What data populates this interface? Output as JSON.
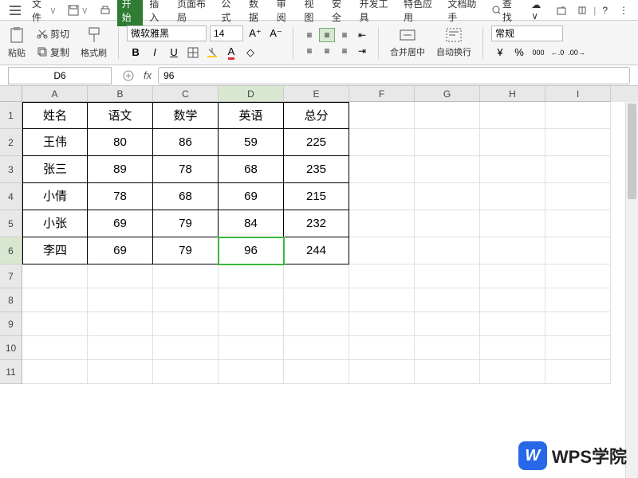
{
  "menubar": {
    "file": "文件",
    "tabs": [
      "开始",
      "插入",
      "页面布局",
      "公式",
      "数据",
      "审阅",
      "视图",
      "安全",
      "开发工具",
      "特色应用",
      "文档助手"
    ],
    "search": "查找"
  },
  "ribbon": {
    "clipboard": {
      "cut": "剪切",
      "copy": "复制",
      "paste": "粘贴",
      "painter": "格式刷"
    },
    "font": {
      "name": "微软雅黑",
      "size": "14"
    },
    "merge": "合并居中",
    "wrap": "自动换行",
    "format_label": "常规",
    "currency": "¥",
    "percent": "%",
    "thousand": "000",
    "dec_inc": ".0",
    "dec_dec": ".00"
  },
  "namebox": "D6",
  "formula": "96",
  "columns": [
    "A",
    "B",
    "C",
    "D",
    "E",
    "F",
    "G",
    "H",
    "I"
  ],
  "rows": [
    "1",
    "2",
    "3",
    "4",
    "5",
    "6",
    "7",
    "8",
    "9",
    "10",
    "11"
  ],
  "headers": [
    "姓名",
    "语文",
    "数学",
    "英语",
    "总分"
  ],
  "data": [
    [
      "王伟",
      "80",
      "86",
      "59",
      "225"
    ],
    [
      "张三",
      "89",
      "78",
      "68",
      "235"
    ],
    [
      "小倩",
      "78",
      "68",
      "69",
      "215"
    ],
    [
      "小张",
      "69",
      "79",
      "84",
      "232"
    ],
    [
      "李四",
      "69",
      "79",
      "96",
      "244"
    ]
  ],
  "chart_data": {
    "type": "table",
    "columns": [
      "姓名",
      "语文",
      "数学",
      "英语",
      "总分"
    ],
    "rows": [
      {
        "姓名": "王伟",
        "语文": 80,
        "数学": 86,
        "英语": 59,
        "总分": 225
      },
      {
        "姓名": "张三",
        "语文": 89,
        "数学": 78,
        "英语": 68,
        "总分": 235
      },
      {
        "姓名": "小倩",
        "语文": 78,
        "数学": 68,
        "英语": 69,
        "总分": 215
      },
      {
        "姓名": "小张",
        "语文": 69,
        "数学": 79,
        "英语": 84,
        "总分": 232
      },
      {
        "姓名": "李四",
        "语文": 69,
        "数学": 79,
        "英语": 96,
        "总分": 244
      }
    ]
  },
  "selected": {
    "col": "D",
    "row": "6"
  },
  "watermark": "WPS学院"
}
